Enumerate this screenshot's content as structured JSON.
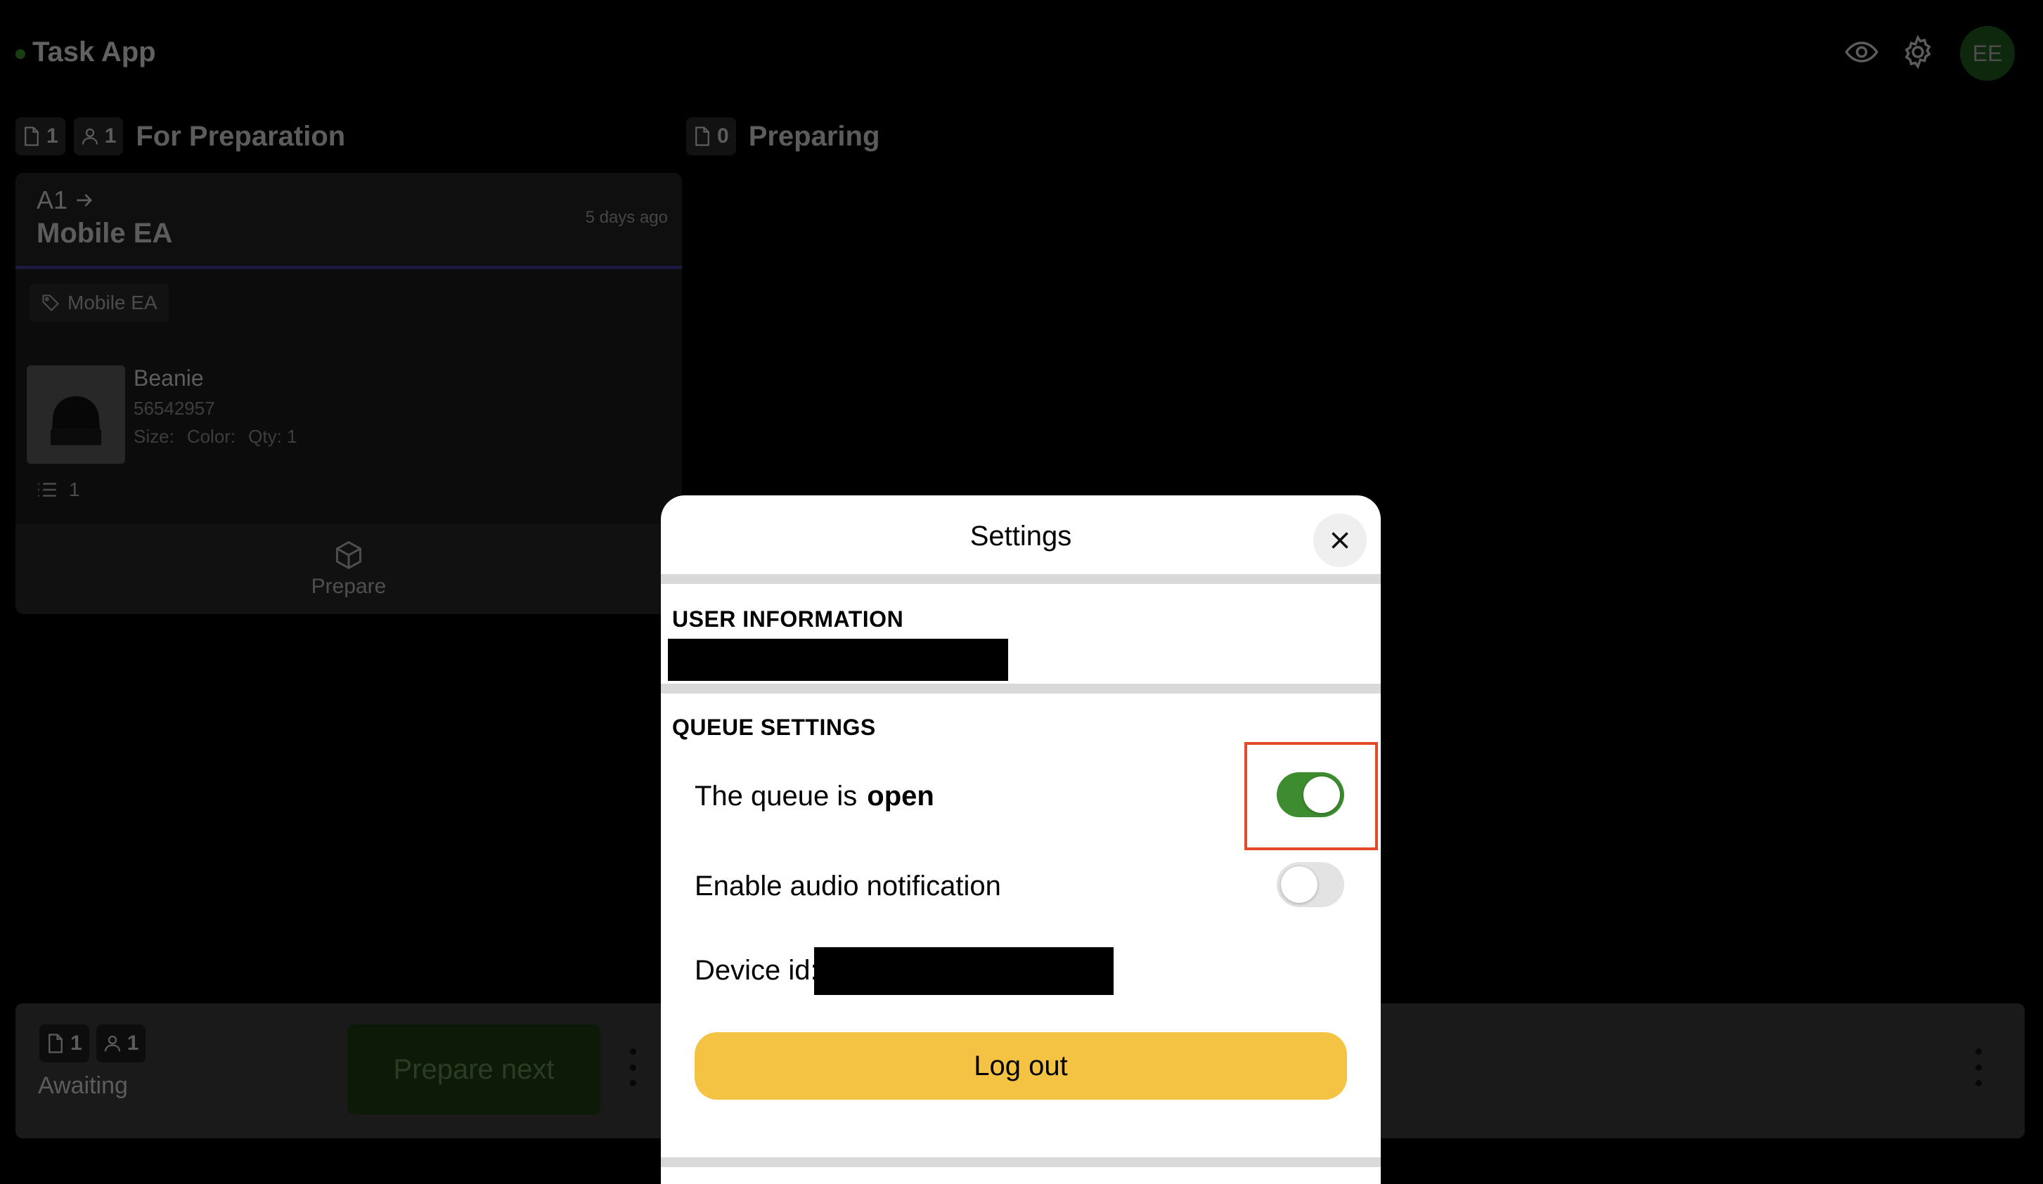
{
  "header": {
    "app_title": "Task App",
    "avatar_initials": "EE"
  },
  "columns": [
    {
      "title": "For Preparation",
      "doc_count": "1",
      "user_count": "1"
    },
    {
      "title": "Preparing",
      "doc_count": "0"
    }
  ],
  "task_card": {
    "code": "A1",
    "name": "Mobile EA",
    "time_ago": "5 days ago",
    "tag": "Mobile EA",
    "item": {
      "name": "Beanie",
      "sku": "56542957",
      "size_label": "Size:",
      "color_label": "Color:",
      "qty_label": "Qty: 1"
    },
    "line_count": "1",
    "action_label": "Prepare"
  },
  "bottom_bar": {
    "doc_count": "1",
    "user_count": "1",
    "status_label": "Awaiting",
    "prepare_next_label": "Prepare next"
  },
  "settings_modal": {
    "title": "Settings",
    "user_section_heading": "USER INFORMATION",
    "queue_section_heading": "QUEUE SETTINGS",
    "queue_label": "The queue is",
    "queue_state": "open",
    "queue_open": true,
    "audio_label": "Enable audio notification",
    "audio_enabled": false,
    "device_id_label": "Device id:",
    "logout_label": "Log out"
  },
  "colors": {
    "toggle_on": "#3d8c2f",
    "logout_button": "#f5c344",
    "highlight_box": "#e24a2a",
    "card_accent": "#3b3a8c"
  }
}
